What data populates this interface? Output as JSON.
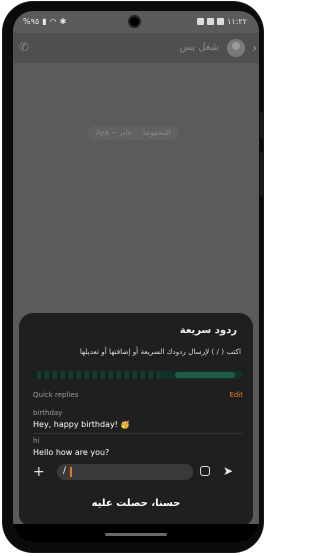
{
  "status_bar": {
    "left": "%٩٥",
    "time": "١١:٢٢"
  },
  "chat": {
    "contact_name": "شغل بس",
    "system_notice_left": "غادر",
    "system_notice_group": "Aya ~ المجموعة"
  },
  "quick_replies_sheet": {
    "title": "ردود سريعة",
    "description": "اكتب ( / ) لإرسال ردودك السريعة أو إضافتها أو تعديلها",
    "header_label": "Quick replies",
    "edit_label": "Edit",
    "items": [
      {
        "shortcut": "birthday",
        "message": "Hey, happy birthday! 🥳"
      },
      {
        "shortcut": "hi",
        "message": "Hello how are you?"
      }
    ],
    "composer_text": "/",
    "confirm_button": "حسنا، حصلت عليه"
  },
  "colors": {
    "accent": "#e07b1a",
    "sheet_bg": "#1f1f1f",
    "overlay": "#5a5a5a"
  }
}
